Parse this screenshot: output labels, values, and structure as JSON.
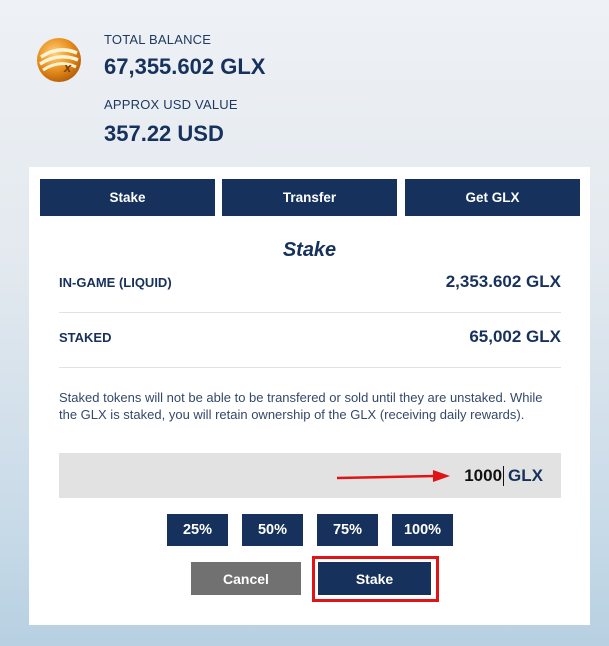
{
  "header": {
    "logo_icon": "galaxy-coin-logo-icon",
    "total_balance_label": "TOTAL BALANCE",
    "total_balance_value": "67,355.602 GLX",
    "usd_label": "APPROX USD VALUE",
    "usd_value": "357.22 USD"
  },
  "tabs": [
    {
      "label": "Stake"
    },
    {
      "label": "Transfer"
    },
    {
      "label": "Get GLX"
    }
  ],
  "stake": {
    "title": "Stake",
    "rows": [
      {
        "label": "IN-GAME (LIQUID)",
        "value": "2,353.602 GLX"
      },
      {
        "label": "STAKED",
        "value": "65,002 GLX"
      }
    ],
    "note": "Staked tokens will not be able to be transfered or sold until they are unstaked. While the GLX is staked, you will retain ownership of the GLX (receiving daily rewards).",
    "amount": {
      "value": "1000",
      "unit": "GLX"
    },
    "percent_buttons": [
      {
        "label": "25%"
      },
      {
        "label": "50%"
      },
      {
        "label": "75%"
      },
      {
        "label": "100%"
      }
    ],
    "cancel_label": "Cancel",
    "stake_label": "Stake"
  },
  "colors": {
    "navy": "#16325c",
    "cancel_gray": "#717171",
    "annotation_red": "#e01414",
    "input_bg": "#e2e2e2"
  }
}
